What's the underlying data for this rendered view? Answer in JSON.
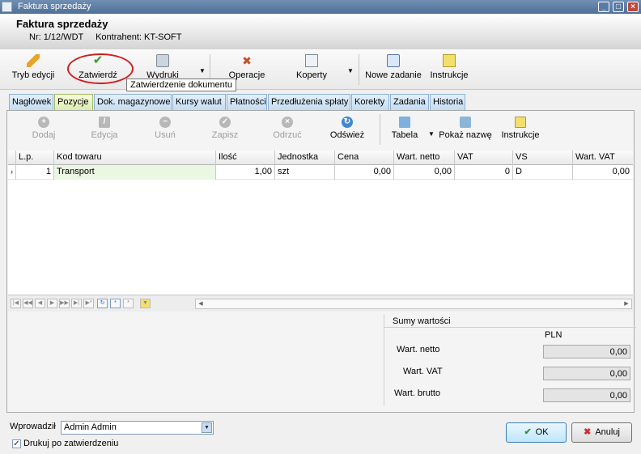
{
  "window": {
    "title": "Faktura sprzedaży"
  },
  "header": {
    "title": "Faktura sprzedaży",
    "number": "Nr: 1/12/WDT",
    "contractor": "Kontrahent: KT-SOFT"
  },
  "toolbar": {
    "edit_mode": "Tryb edycji",
    "approve": "Zatwierdź",
    "prints": "Wydruki",
    "operations": "Operacje",
    "envelopes": "Koperty",
    "new_task": "Nowe zadanie",
    "instructions": "Instrukcje"
  },
  "tooltip": "Zatwierdzenie dokumentu",
  "tabs": [
    "Nagłówek",
    "Pozycje",
    "Dok. magazynowe",
    "Kursy walut",
    "Płatności",
    "Przedłużenia spłaty",
    "Korekty",
    "Zadania",
    "Historia"
  ],
  "active_tab": "Pozycje",
  "positions_toolbar": {
    "add": "Dodaj",
    "edit": "Edycja",
    "delete": "Usuń",
    "save": "Zapisz",
    "reject": "Odrzuć",
    "refresh": "Odśwież",
    "table": "Tabela",
    "show_name": "Pokaż nazwę",
    "instructions": "Instrukcje"
  },
  "grid": {
    "columns": [
      "L.p.",
      "Kod towaru",
      "Ilość",
      "Jednostka",
      "Cena",
      "Wart. netto",
      "VAT",
      "VS",
      "Wart. VAT"
    ],
    "rows": [
      {
        "lp": "1",
        "code": "Transport",
        "qty": "1,00",
        "unit": "szt",
        "price": "0,00",
        "net": "0,00",
        "vat": "0",
        "vs": "D",
        "vat_value": "0,00"
      }
    ]
  },
  "sums": {
    "caption": "Sumy wartości",
    "currency": "PLN",
    "net_label": "Wart. netto",
    "net_value": "0,00",
    "vat_label": "Wart. VAT",
    "vat_value": "0,00",
    "gross_label": "Wart. brutto",
    "gross_value": "0,00"
  },
  "footer": {
    "entered_by_label": "Wprowadził",
    "entered_by_value": "Admin Admin",
    "print_after_approve_label": "Drukuj po zatwierdzeniu",
    "print_after_approve_checked": true,
    "ok": "OK",
    "cancel": "Anuluj"
  },
  "colors": {
    "highlight": "#d11d1d",
    "active_tab": "#dcebb0",
    "tab": "#c4dcf2"
  }
}
